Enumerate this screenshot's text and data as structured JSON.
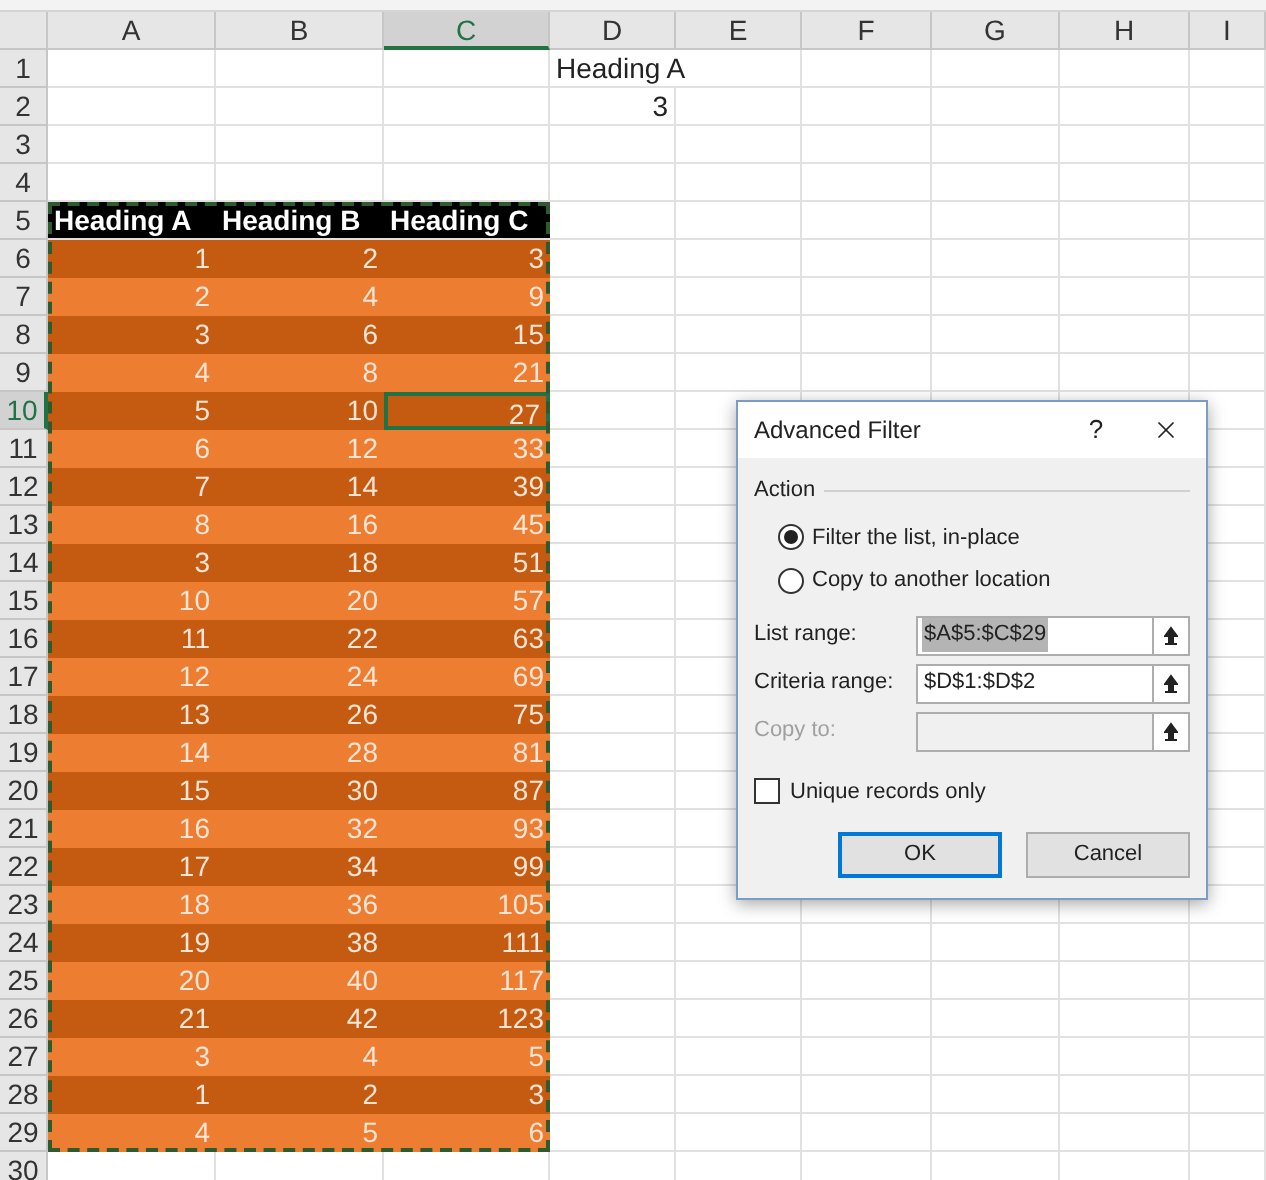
{
  "sheet": {
    "columns": [
      {
        "label": "A",
        "selected": false
      },
      {
        "label": "B",
        "selected": false
      },
      {
        "label": "C",
        "selected": true
      },
      {
        "label": "D",
        "selected": false
      },
      {
        "label": "E",
        "selected": false
      },
      {
        "label": "F",
        "selected": false
      },
      {
        "label": "G",
        "selected": false
      },
      {
        "label": "H",
        "selected": false
      },
      {
        "label": "I",
        "selected": false
      }
    ],
    "rows": [
      {
        "label": "1",
        "selected": false
      },
      {
        "label": "2",
        "selected": false
      },
      {
        "label": "3",
        "selected": false
      },
      {
        "label": "4",
        "selected": false
      },
      {
        "label": "5",
        "selected": false
      },
      {
        "label": "6",
        "selected": false
      },
      {
        "label": "7",
        "selected": false
      },
      {
        "label": "8",
        "selected": false
      },
      {
        "label": "9",
        "selected": false
      },
      {
        "label": "10",
        "selected": true
      },
      {
        "label": "11",
        "selected": false
      },
      {
        "label": "12",
        "selected": false
      },
      {
        "label": "13",
        "selected": false
      },
      {
        "label": "14",
        "selected": false
      },
      {
        "label": "15",
        "selected": false
      },
      {
        "label": "16",
        "selected": false
      },
      {
        "label": "17",
        "selected": false
      },
      {
        "label": "18",
        "selected": false
      },
      {
        "label": "19",
        "selected": false
      },
      {
        "label": "20",
        "selected": false
      },
      {
        "label": "21",
        "selected": false
      },
      {
        "label": "22",
        "selected": false
      },
      {
        "label": "23",
        "selected": false
      },
      {
        "label": "24",
        "selected": false
      },
      {
        "label": "25",
        "selected": false
      },
      {
        "label": "26",
        "selected": false
      },
      {
        "label": "27",
        "selected": false
      },
      {
        "label": "28",
        "selected": false
      },
      {
        "label": "29",
        "selected": false
      },
      {
        "label": "30",
        "selected": false
      }
    ]
  },
  "criteria": {
    "heading": "Heading A",
    "value": "3"
  },
  "table": {
    "headings": [
      "Heading A",
      "Heading B",
      "Heading C"
    ],
    "rows": [
      {
        "cells": [
          {
            "text": "1",
            "selected": false
          },
          {
            "text": "2",
            "selected": false
          },
          {
            "text": "3",
            "selected": false
          }
        ]
      },
      {
        "cells": [
          {
            "text": "2",
            "selected": false
          },
          {
            "text": "4",
            "selected": false
          },
          {
            "text": "9",
            "selected": false
          }
        ]
      },
      {
        "cells": [
          {
            "text": "3",
            "selected": false
          },
          {
            "text": "6",
            "selected": false
          },
          {
            "text": "15",
            "selected": false
          }
        ]
      },
      {
        "cells": [
          {
            "text": "4",
            "selected": false
          },
          {
            "text": "8",
            "selected": false
          },
          {
            "text": "21",
            "selected": false
          }
        ]
      },
      {
        "cells": [
          {
            "text": "5",
            "selected": false
          },
          {
            "text": "10",
            "selected": false
          },
          {
            "text": "27",
            "selected": true
          }
        ]
      },
      {
        "cells": [
          {
            "text": "6",
            "selected": false
          },
          {
            "text": "12",
            "selected": false
          },
          {
            "text": "33",
            "selected": false
          }
        ]
      },
      {
        "cells": [
          {
            "text": "7",
            "selected": false
          },
          {
            "text": "14",
            "selected": false
          },
          {
            "text": "39",
            "selected": false
          }
        ]
      },
      {
        "cells": [
          {
            "text": "8",
            "selected": false
          },
          {
            "text": "16",
            "selected": false
          },
          {
            "text": "45",
            "selected": false
          }
        ]
      },
      {
        "cells": [
          {
            "text": "3",
            "selected": false
          },
          {
            "text": "18",
            "selected": false
          },
          {
            "text": "51",
            "selected": false
          }
        ]
      },
      {
        "cells": [
          {
            "text": "10",
            "selected": false
          },
          {
            "text": "20",
            "selected": false
          },
          {
            "text": "57",
            "selected": false
          }
        ]
      },
      {
        "cells": [
          {
            "text": "11",
            "selected": false
          },
          {
            "text": "22",
            "selected": false
          },
          {
            "text": "63",
            "selected": false
          }
        ]
      },
      {
        "cells": [
          {
            "text": "12",
            "selected": false
          },
          {
            "text": "24",
            "selected": false
          },
          {
            "text": "69",
            "selected": false
          }
        ]
      },
      {
        "cells": [
          {
            "text": "13",
            "selected": false
          },
          {
            "text": "26",
            "selected": false
          },
          {
            "text": "75",
            "selected": false
          }
        ]
      },
      {
        "cells": [
          {
            "text": "14",
            "selected": false
          },
          {
            "text": "28",
            "selected": false
          },
          {
            "text": "81",
            "selected": false
          }
        ]
      },
      {
        "cells": [
          {
            "text": "15",
            "selected": false
          },
          {
            "text": "30",
            "selected": false
          },
          {
            "text": "87",
            "selected": false
          }
        ]
      },
      {
        "cells": [
          {
            "text": "16",
            "selected": false
          },
          {
            "text": "32",
            "selected": false
          },
          {
            "text": "93",
            "selected": false
          }
        ]
      },
      {
        "cells": [
          {
            "text": "17",
            "selected": false
          },
          {
            "text": "34",
            "selected": false
          },
          {
            "text": "99",
            "selected": false
          }
        ]
      },
      {
        "cells": [
          {
            "text": "18",
            "selected": false
          },
          {
            "text": "36",
            "selected": false
          },
          {
            "text": "105",
            "selected": false
          }
        ]
      },
      {
        "cells": [
          {
            "text": "19",
            "selected": false
          },
          {
            "text": "38",
            "selected": false
          },
          {
            "text": "111",
            "selected": false
          }
        ]
      },
      {
        "cells": [
          {
            "text": "20",
            "selected": false
          },
          {
            "text": "40",
            "selected": false
          },
          {
            "text": "117",
            "selected": false
          }
        ]
      },
      {
        "cells": [
          {
            "text": "21",
            "selected": false
          },
          {
            "text": "42",
            "selected": false
          },
          {
            "text": "123",
            "selected": false
          }
        ]
      },
      {
        "cells": [
          {
            "text": "3",
            "selected": false
          },
          {
            "text": "4",
            "selected": false
          },
          {
            "text": "5",
            "selected": false
          }
        ]
      },
      {
        "cells": [
          {
            "text": "1",
            "selected": false
          },
          {
            "text": "2",
            "selected": false
          },
          {
            "text": "3",
            "selected": false
          }
        ]
      },
      {
        "cells": [
          {
            "text": "4",
            "selected": false
          },
          {
            "text": "5",
            "selected": false
          },
          {
            "text": "6",
            "selected": false
          }
        ]
      }
    ]
  },
  "dialog": {
    "title": "Advanced Filter",
    "help": "?",
    "group_label": "Action",
    "radios": [
      {
        "label": "Filter the list, in-place",
        "selected": true
      },
      {
        "label": "Copy to another location",
        "selected": false
      }
    ],
    "fields": [
      {
        "label": "List range:",
        "value": "$A$5:$C$29",
        "disabled": false,
        "highlighted": true
      },
      {
        "label": "Criteria range:",
        "value": "$D$1:$D$2",
        "disabled": false,
        "highlighted": false
      },
      {
        "label": "Copy to:",
        "disabled": true
      }
    ],
    "checkbox": {
      "label": "Unique records only",
      "checked": false
    },
    "buttons": [
      {
        "label": "OK",
        "default": true
      },
      {
        "label": "Cancel",
        "default": false
      }
    ]
  }
}
